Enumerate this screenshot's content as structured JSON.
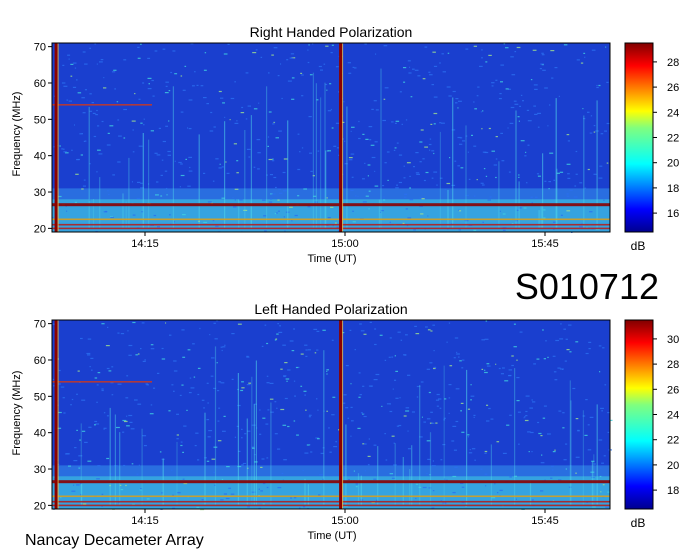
{
  "figure": {
    "session_id": "S010712",
    "footer_label": "Nancay Decameter Array"
  },
  "chart_data": [
    {
      "type": "heatmap",
      "title": "Right Handed Polarization",
      "xlabel": "Time (UT)",
      "ylabel": "Frequency (MHz)",
      "x_ticks": [
        "14:15",
        "15:00",
        "15:45"
      ],
      "y_ticks": [
        20,
        30,
        40,
        50,
        60,
        70
      ],
      "ylim": [
        19,
        71
      ],
      "colorbar": {
        "label": "dB",
        "ticks": [
          16,
          18,
          20,
          22,
          24,
          26,
          28
        ],
        "range": [
          14.5,
          29.5
        ]
      },
      "features": {
        "horizontal_bands_mhz": [
          26.5,
          22.5,
          21.0,
          20.0,
          54.0
        ],
        "vertical_lines_time": [
          "13:55",
          "14:59"
        ]
      }
    },
    {
      "type": "heatmap",
      "title": "Left Handed Polarization",
      "xlabel": "Time (UT)",
      "ylabel": "Frequency (MHz)",
      "x_ticks": [
        "14:15",
        "15:00",
        "15:45"
      ],
      "y_ticks": [
        20,
        30,
        40,
        50,
        60,
        70
      ],
      "ylim": [
        19,
        71
      ],
      "colorbar": {
        "label": "dB",
        "ticks": [
          18,
          20,
          22,
          24,
          26,
          28,
          30
        ],
        "range": [
          16.5,
          31.5
        ]
      },
      "features": {
        "horizontal_bands_mhz": [
          26.5,
          22.5,
          21.0,
          20.0,
          54.0
        ],
        "vertical_lines_time": [
          "13:55",
          "14:59"
        ]
      }
    }
  ],
  "colors": {
    "background_low": "#1a3fcf",
    "band_high": "#8b0000",
    "mid": "#3fd0e0"
  }
}
